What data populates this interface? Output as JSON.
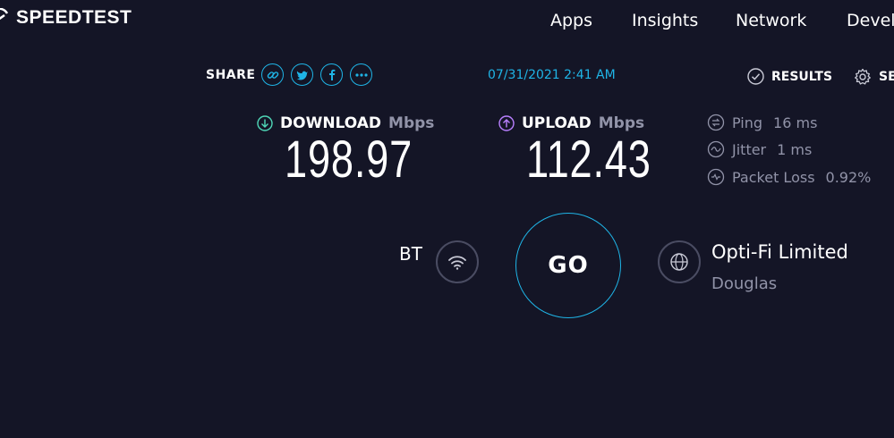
{
  "header": {
    "logo_text": "SPEEDTEST",
    "nav": [
      "Apps",
      "Insights",
      "Network",
      "Devel"
    ]
  },
  "share": {
    "label": "SHARE",
    "icons": [
      "link-icon",
      "twitter-icon",
      "facebook-icon",
      "more-icon"
    ]
  },
  "timestamp": "07/31/2021 2:41 AM",
  "results_label": "RESULTS",
  "settings_label": "SE",
  "download": {
    "label": "DOWNLOAD",
    "unit": "Mbps",
    "value": "198.97"
  },
  "upload": {
    "label": "UPLOAD",
    "unit": "Mbps",
    "value": "112.43"
  },
  "stats": {
    "ping": {
      "label": "Ping",
      "value": "16 ms"
    },
    "jitter": {
      "label": "Jitter",
      "value": "1 ms"
    },
    "packet_loss": {
      "label": "Packet Loss",
      "value": "0.92%"
    }
  },
  "connection": {
    "isp": "BT",
    "go_label": "GO",
    "server_name": "Opti-Fi Limited",
    "server_location": "Douglas"
  },
  "colors": {
    "background": "#141526",
    "accent": "#1fb4e6",
    "download_icon": "#4fd8b8",
    "upload_icon": "#b980ff",
    "muted": "#9193a8"
  }
}
